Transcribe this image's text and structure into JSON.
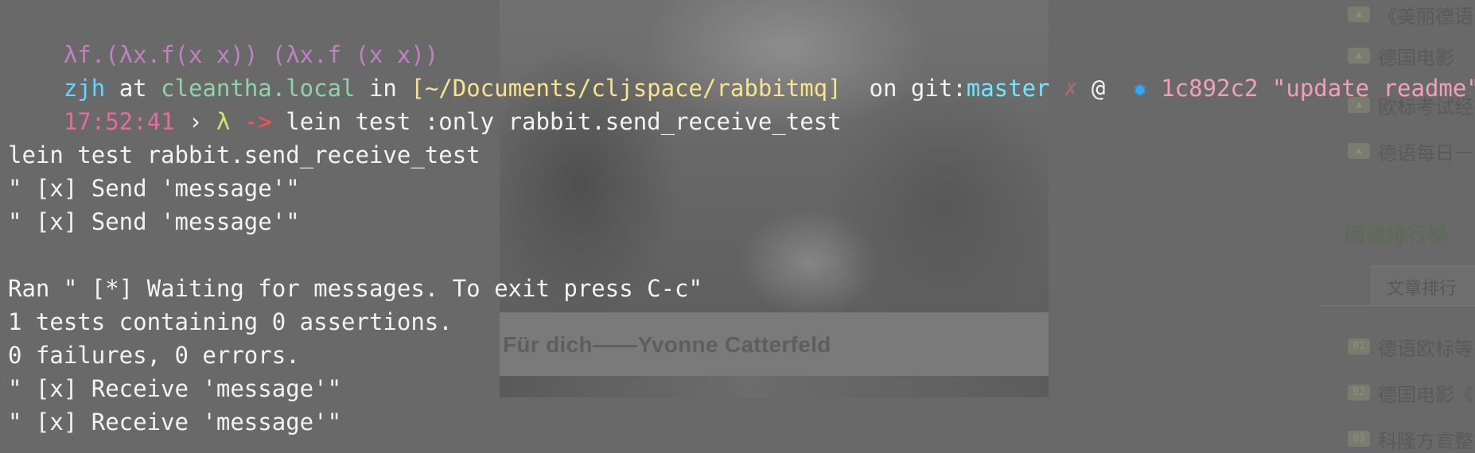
{
  "colors": {
    "text": "#f3f3f3",
    "lambda_banner": "#c081c4",
    "user": "#5fd7ff",
    "host": "#8fd3a8",
    "path": "#f8e48a",
    "branch": "#6ee8ff",
    "dirty": "#a07070",
    "commit_icon": "#2fa8ff",
    "commit": "#f0a0b8",
    "time": "#e46aa0",
    "prompt_lambda": "#cfe86a",
    "arrow": "#ff5050"
  },
  "background_page": {
    "photo_caption": "Für dich——Yvonne Catterfeld",
    "sidebar": {
      "top_items": [
        {
          "icon": "▲",
          "label": "《美丽德语"
        },
        {
          "icon": "▲",
          "label": "德国电影"
        },
        {
          "icon": "▲",
          "label": "欧标考试经"
        },
        {
          "icon": "▲",
          "label": "德语每日一"
        }
      ],
      "heading": "阅读排行榜",
      "tab": "文章排行",
      "bottom_items": [
        {
          "icon": "01",
          "label": "德语欧标等"
        },
        {
          "icon": "02",
          "label": "德国电影《"
        },
        {
          "icon": "03",
          "label": "科隆方言整"
        }
      ]
    }
  },
  "terminal": {
    "banner": "λf.(λx.f(x x)) (λx.f (x x))",
    "prompt": {
      "user": "zjh",
      "at": " at ",
      "host": "cleantha.local",
      "in": " in ",
      "path": "[~/Documents/cljspace/rabbitmq]",
      "on_git": "  on git:",
      "branch": "master",
      "dirty_mark": " ✗",
      "at_sign": " @ ",
      "commit_icon": " ✹ ",
      "commit": "1c892c2 \"update readme\"",
      "time": "17:52:41",
      "chevron": " › ",
      "lambda": "λ",
      "arrow": " -> ",
      "command": "lein test :only rabbit.send_receive_test"
    },
    "output_lines": [
      "",
      "lein test rabbit.send_receive_test",
      "\" [x] Send 'message'\"",
      "\" [x] Send 'message'\"",
      "",
      "Ran \" [*] Waiting for messages. To exit press C-c\"",
      "1 tests containing 0 assertions.",
      "0 failures, 0 errors.",
      "\" [x] Receive 'message'\"",
      "\" [x] Receive 'message'\""
    ]
  }
}
